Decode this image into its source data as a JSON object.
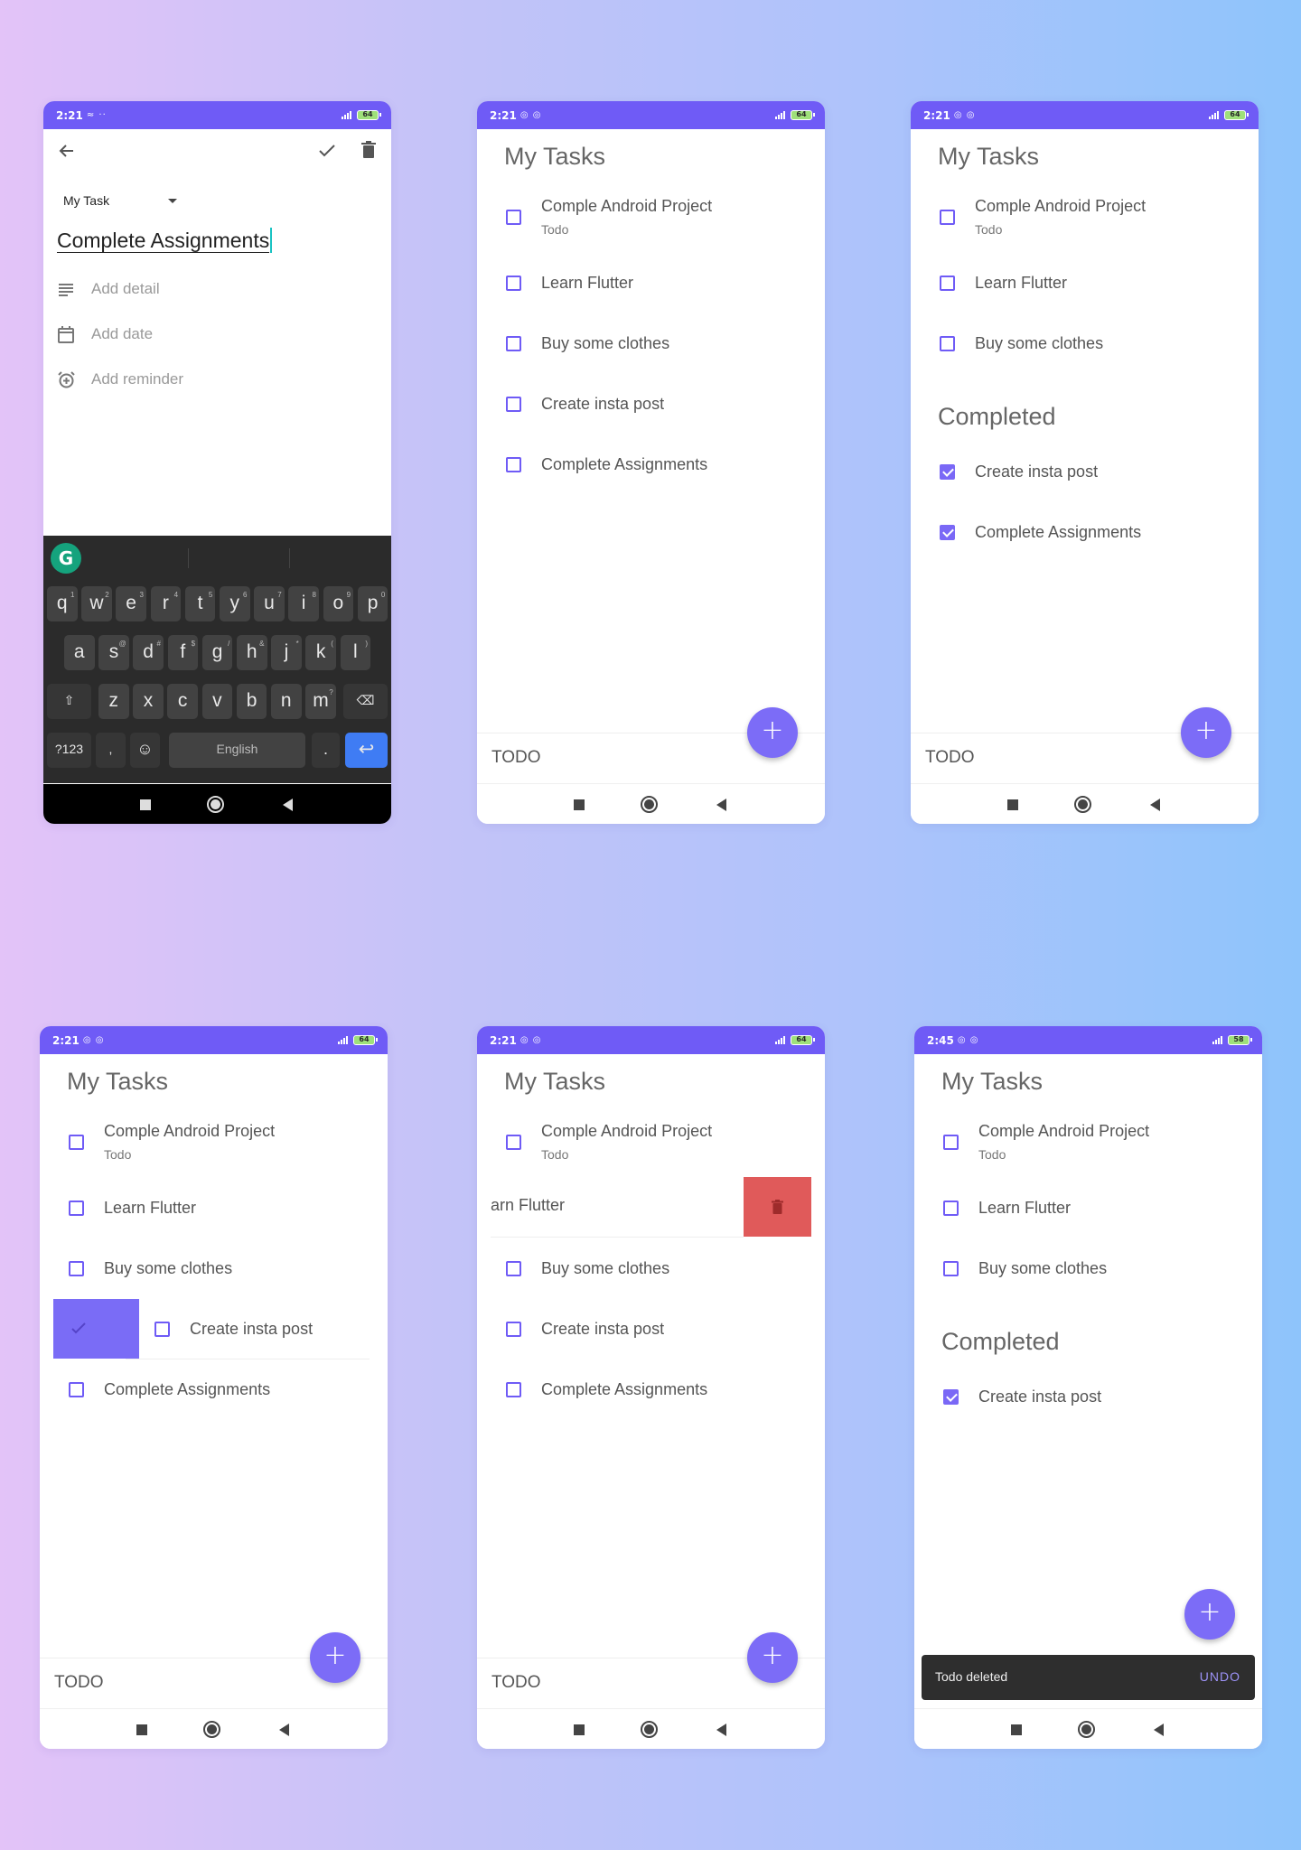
{
  "colors": {
    "accent": "#6f5bf6",
    "checkbox": "#6f5bf6",
    "delete": "#e05a5a",
    "snackbar": "#2e2e2e"
  },
  "screens": {
    "editor": {
      "status": {
        "time": "2:21",
        "icons": "≈ ··",
        "battery": "64"
      },
      "list_selector": "My Task",
      "task_title": "Complete Assignments",
      "detail_placeholder": "Add detail",
      "date_placeholder": "Add date",
      "reminder_placeholder": "Add reminder",
      "keyboard": {
        "row1": [
          "q",
          "w",
          "e",
          "r",
          "t",
          "y",
          "u",
          "i",
          "o",
          "p"
        ],
        "row1_hints": [
          "1",
          "2",
          "3",
          "4",
          "5",
          "6",
          "7",
          "8",
          "9",
          "0"
        ],
        "row2": [
          "a",
          "s",
          "d",
          "f",
          "g",
          "h",
          "j",
          "k",
          "l"
        ],
        "row2_hints": [
          "",
          "@",
          "#",
          "$",
          "/",
          "&",
          "*",
          "(",
          ")"
        ],
        "row3": [
          "z",
          "x",
          "c",
          "v",
          "b",
          "n",
          "m"
        ],
        "row3_hints": [
          "",
          "",
          "",
          "",
          "",
          "",
          "?"
        ],
        "symbols_key": "?123",
        "comma_key": ",",
        "emoji_key": "☺",
        "space_label": "English",
        "period_key": ".",
        "shift_key": "⇧",
        "backspace_key": "⌫",
        "enter_key": "↩",
        "grammarly": "G"
      }
    },
    "list1": {
      "status": {
        "time": "2:21",
        "icons": "◎ ◎",
        "battery": "64"
      },
      "title": "My Tasks",
      "tasks": [
        {
          "label": "Comple Android Project",
          "sub": "Todo"
        },
        {
          "label": "Learn Flutter"
        },
        {
          "label": "Buy some clothes"
        },
        {
          "label": "Create insta post"
        },
        {
          "label": "Complete Assignments"
        }
      ],
      "bottom_label": "TODO",
      "fab": "+"
    },
    "list2": {
      "status": {
        "time": "2:21",
        "icons": "◎ ◎",
        "battery": "64"
      },
      "title": "My Tasks",
      "tasks": [
        {
          "label": "Comple Android Project",
          "sub": "Todo"
        },
        {
          "label": "Learn Flutter"
        },
        {
          "label": "Buy some clothes"
        }
      ],
      "completed_title": "Completed",
      "completed": [
        {
          "label": "Create insta post"
        },
        {
          "label": "Complete Assignments"
        }
      ],
      "bottom_label": "TODO",
      "fab": "+"
    },
    "list3": {
      "status": {
        "time": "2:21",
        "icons": "◎ ◎",
        "battery": "64"
      },
      "title": "My Tasks",
      "tasks": [
        {
          "label": "Comple Android Project",
          "sub": "Todo"
        },
        {
          "label": "Learn Flutter"
        },
        {
          "label": "Buy some clothes"
        },
        {
          "label": "Create insta post"
        },
        {
          "label": "Complete Assignments"
        }
      ],
      "bottom_label": "TODO",
      "fab": "+"
    },
    "list4": {
      "status": {
        "time": "2:21",
        "icons": "◎ ◎",
        "battery": "64"
      },
      "title": "My Tasks",
      "tasks": [
        {
          "label": "Comple Android Project",
          "sub": "Todo"
        },
        {
          "label": "arn Flutter"
        },
        {
          "label": "Buy some clothes"
        },
        {
          "label": "Create insta post"
        },
        {
          "label": "Complete Assignments"
        }
      ],
      "bottom_label": "TODO",
      "fab": "+"
    },
    "list5": {
      "status": {
        "time": "2:45",
        "icons": "◎ ◎",
        "battery": "58"
      },
      "title": "My Tasks",
      "tasks": [
        {
          "label": "Comple Android Project",
          "sub": "Todo"
        },
        {
          "label": "Learn Flutter"
        },
        {
          "label": "Buy some clothes"
        }
      ],
      "completed_title": "Completed",
      "completed": [
        {
          "label": "Create insta post"
        }
      ],
      "snackbar": {
        "message": "Todo deleted",
        "action": "UNDO"
      },
      "fab": "+"
    }
  }
}
